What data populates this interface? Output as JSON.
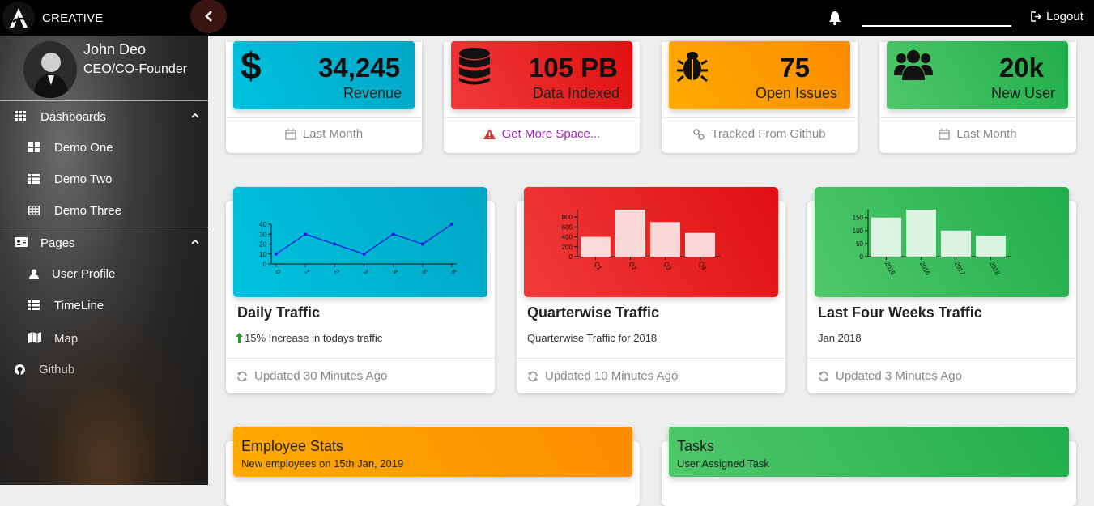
{
  "topbar": {
    "brand": "CREATIVE",
    "logout": "Logout"
  },
  "profile": {
    "name": "John Deo",
    "role": "CEO/CO-Founder"
  },
  "sidebar": {
    "dashboards": {
      "label": "Dashboards",
      "items": [
        "Demo One",
        "Demo Two",
        "Demo Three"
      ]
    },
    "pages": {
      "label": "Pages",
      "items": [
        "User Profile",
        "TimeLine",
        "Map"
      ]
    },
    "github": "Github"
  },
  "stats": [
    {
      "value": "34,245",
      "label": "Revenue",
      "footer": "Last Month",
      "color": "#00bcd4"
    },
    {
      "value": "105 PB",
      "label": "Data Indexed",
      "footer": "Get More Space...",
      "color": "#f44336"
    },
    {
      "value": "75",
      "label": "Open Issues",
      "footer": "Tracked From Github",
      "color": "#ff9800"
    },
    {
      "value": "20k",
      "label": "New User",
      "footer": "Last Month",
      "color": "#4caf50"
    }
  ],
  "charts": [
    {
      "title": "Daily Traffic",
      "subtitle": "15% Increase in todays traffic",
      "footer": "Updated 30 Minutes Ago"
    },
    {
      "title": "Quarterwise Traffic",
      "subtitle": "Quarterwise Traffic for 2018",
      "footer": "Updated 10 Minutes Ago"
    },
    {
      "title": "Last Four Weeks Traffic",
      "subtitle": "Jan 2018",
      "footer": "Updated 3 Minutes Ago"
    }
  ],
  "chart_data": [
    {
      "type": "line",
      "x": [
        "0",
        "1",
        "2",
        "3",
        "4",
        "5",
        "6"
      ],
      "values": [
        10,
        30,
        20,
        10,
        30,
        20,
        40
      ],
      "yticks": [
        0,
        10,
        20,
        30,
        40
      ],
      "ylim": [
        0,
        40
      ]
    },
    {
      "type": "bar",
      "categories": [
        "Q1",
        "Q2",
        "Q3",
        "Q4"
      ],
      "values": [
        400,
        950,
        700,
        480
      ],
      "yticks": [
        0,
        200,
        400,
        600,
        800
      ],
      "ylim": [
        0,
        950
      ]
    },
    {
      "type": "bar",
      "categories": [
        "2015",
        "2016",
        "2017",
        "2018"
      ],
      "values": [
        150,
        180,
        100,
        80
      ],
      "yticks": [
        0,
        50,
        100,
        150
      ],
      "ylim": [
        0,
        180
      ]
    }
  ],
  "bottom": [
    {
      "title": "Employee Stats",
      "subtitle": "New employees on 15th Jan, 2019"
    },
    {
      "title": "Tasks",
      "subtitle": "User Assigned Task"
    }
  ]
}
